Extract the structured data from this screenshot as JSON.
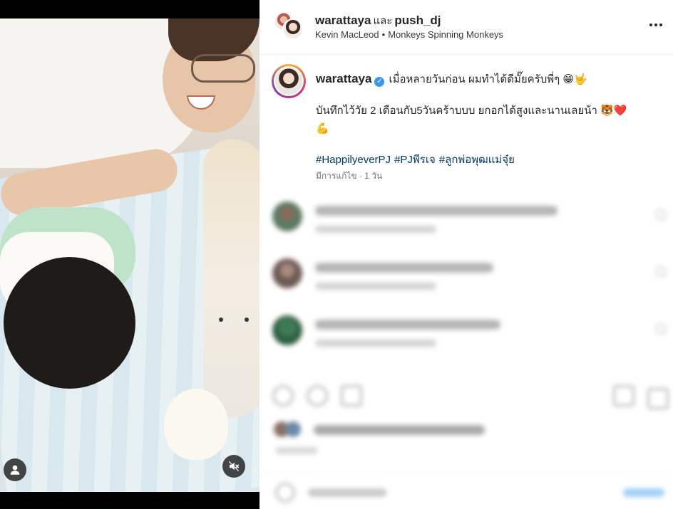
{
  "post": {
    "media": {
      "user_tag_icon": "person-icon",
      "mute_icon": "speaker-muted-icon"
    },
    "header": {
      "author1": "warattaya",
      "joiner": "และ",
      "author2": "push_dj",
      "music_artist": "Kevin MacLeod",
      "separator": "•",
      "music_title": "Monkeys Spinning Monkeys"
    },
    "caption": {
      "username": "warattaya",
      "verified_icon": "verified-badge-icon",
      "line1": "เมื่อหลายวันก่อน ผมทำได้ดีมั๊ยครับพี่ๆ",
      "line1_emoji": "😁🤟",
      "line2": "บันทึกไว้วัย 2 เดือนกับ5วันคร้าบบบ ยกอกได้สูงและนานเลยน้า",
      "line2_emoji": "🐯❤️",
      "line3_emoji": "💪",
      "hashtags": [
        "#HappilyeverPJ",
        "#PJพีรเจ",
        "#ลูกพ่อพุฒแม่จุ๋ย"
      ],
      "meta": "มีการแก้ไข · 1 วัน"
    },
    "colors": {
      "verified": "#3897f0",
      "hashtag": "#00376b",
      "meta_text": "#737373",
      "text": "#262626"
    }
  }
}
